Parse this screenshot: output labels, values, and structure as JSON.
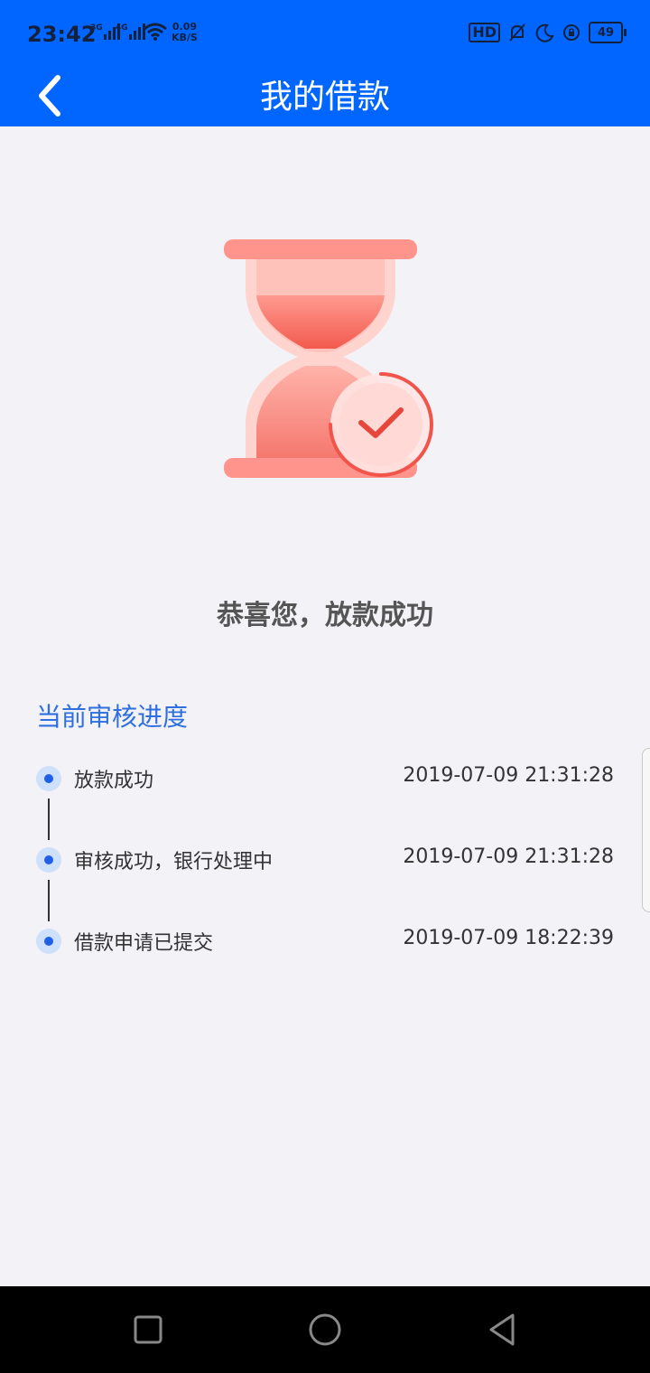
{
  "status_bar": {
    "time": "23:42",
    "signal_1": "3G",
    "signal_2": "4G",
    "speed_value": "0.09",
    "speed_unit": "KB/S",
    "hd_label": "HD",
    "battery": "49"
  },
  "header": {
    "title": "我的借款",
    "back_icon": "chevron-left-icon"
  },
  "result": {
    "illustration": "hourglass-check-icon",
    "title": "恭喜您，放款成功"
  },
  "progress": {
    "section_title": "当前审核进度",
    "steps": [
      {
        "label": "放款成功",
        "time": "2019-07-09 21:31:28"
      },
      {
        "label": "审核成功，银行处理中",
        "time": "2019-07-09 21:31:28"
      },
      {
        "label": "借款申请已提交",
        "time": "2019-07-09 18:22:39"
      }
    ]
  },
  "colors": {
    "header_bg": "#0066ff",
    "page_bg": "#f2f2f7",
    "accent_blue": "#2f6fe0",
    "hourglass_red": "#f0544a"
  },
  "system_nav": {
    "recent_icon": "square-icon",
    "home_icon": "circle-icon",
    "back_icon": "triangle-back-icon"
  }
}
